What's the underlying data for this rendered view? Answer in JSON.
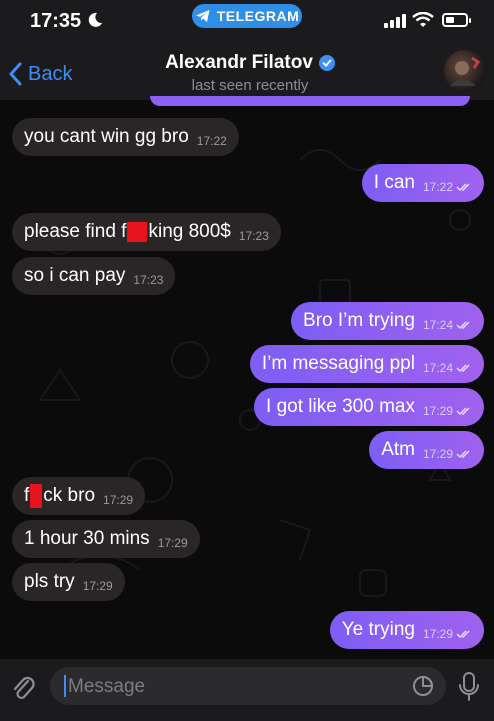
{
  "status_bar": {
    "time": "17:35",
    "app_pill": "TELEGRAM"
  },
  "header": {
    "back_label": "Back",
    "name": "Alexandr Filatov",
    "subtitle": "last seen recently"
  },
  "messages": [
    {
      "side": "in",
      "text": "you cant win gg bro",
      "time": "17:22"
    },
    {
      "side": "out",
      "text": "I can",
      "time": "17:22"
    },
    {
      "side": "in",
      "text_before": "please find f",
      "text_after": "king 800$",
      "time": "17:23"
    },
    {
      "side": "in",
      "text": "so i can pay",
      "time": "17:23"
    },
    {
      "side": "out",
      "text": "Bro I’m trying",
      "time": "17:24"
    },
    {
      "side": "out",
      "text": "I’m messaging ppl",
      "time": "17:24"
    },
    {
      "side": "out",
      "text": "I got like 300 max",
      "time": "17:29"
    },
    {
      "side": "out",
      "text": "Atm",
      "time": "17:29"
    },
    {
      "side": "in",
      "text_before": "f",
      "text_after": "ck bro",
      "time": "17:29"
    },
    {
      "side": "in",
      "text": "1 hour 30 mins",
      "time": "17:29"
    },
    {
      "side": "in",
      "text": "pls try",
      "time": "17:29"
    },
    {
      "side": "out",
      "text": "Ye trying",
      "time": "17:29"
    }
  ],
  "input": {
    "placeholder": "Message"
  },
  "colors": {
    "accent": "#3d8ef5",
    "incoming_bubble": "#2a2527",
    "outgoing_bubble": "#8b60f2",
    "redaction": "#e8141c"
  }
}
